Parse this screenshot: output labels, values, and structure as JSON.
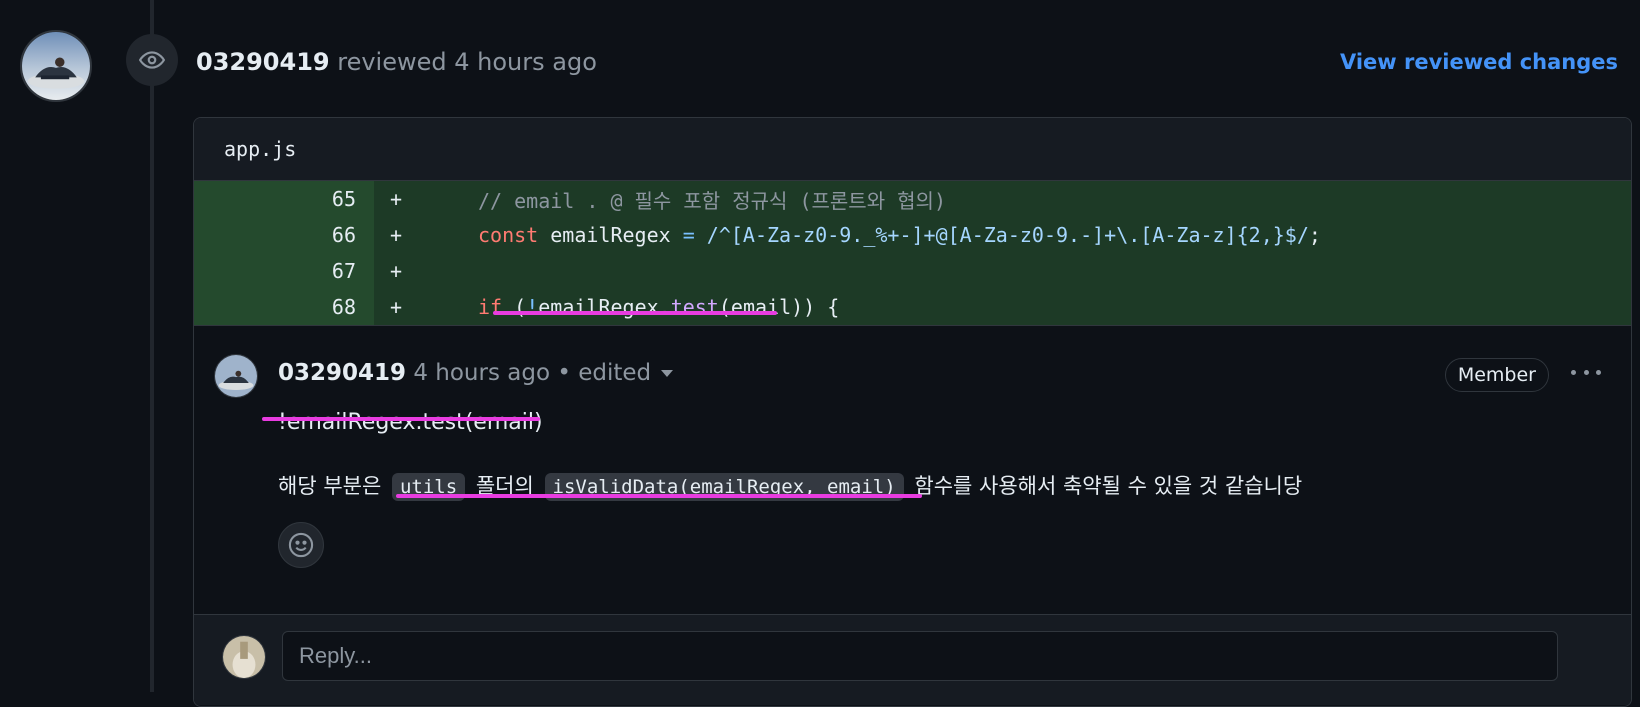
{
  "review": {
    "author": "03290419",
    "action": "reviewed",
    "time": "4 hours ago",
    "view_link": "View reviewed changes"
  },
  "file": {
    "name": "app.js",
    "lines": [
      {
        "num": "65",
        "sign": "+"
      },
      {
        "num": "66",
        "sign": "+"
      },
      {
        "num": "67",
        "sign": "+"
      },
      {
        "num": "68",
        "sign": "+"
      }
    ],
    "code": {
      "l65": "// email . @ 필수 포함 정규식 (프론트와 협의)",
      "l66_kw": "const",
      "l66_name": " emailRegex ",
      "l66_eq": "=",
      "l66_regex": " /^[A-Za-z0-9._%+-]+@[A-Za-z0-9.-]+\\.[A-Za-z]{2,}$/",
      "l66_end": ";",
      "l68_kw": "if",
      "l68_open": " (",
      "l68_not": "!",
      "l68_obj": "emailRegex.",
      "l68_fn": "test",
      "l68_rest": "(email)) {"
    }
  },
  "comment": {
    "author": "03290419",
    "time": "4 hours ago",
    "edited": " • edited",
    "badge": "Member",
    "code_line": "!emailRegex.test(email)",
    "body_1": "해당 부분은",
    "code_1": "utils",
    "body_2": "폴더의",
    "code_2": "isValidData(emailRegex, email)",
    "body_3": "함수를 사용해서 축약될 수 있을 것 같습니당"
  },
  "reply": {
    "placeholder": "Reply..."
  },
  "colors": {
    "accent_link": "#4493f8",
    "highlight": "#e83ce0",
    "added_line_bg": "#1d3a26",
    "added_num_bg": "#244a2d"
  }
}
